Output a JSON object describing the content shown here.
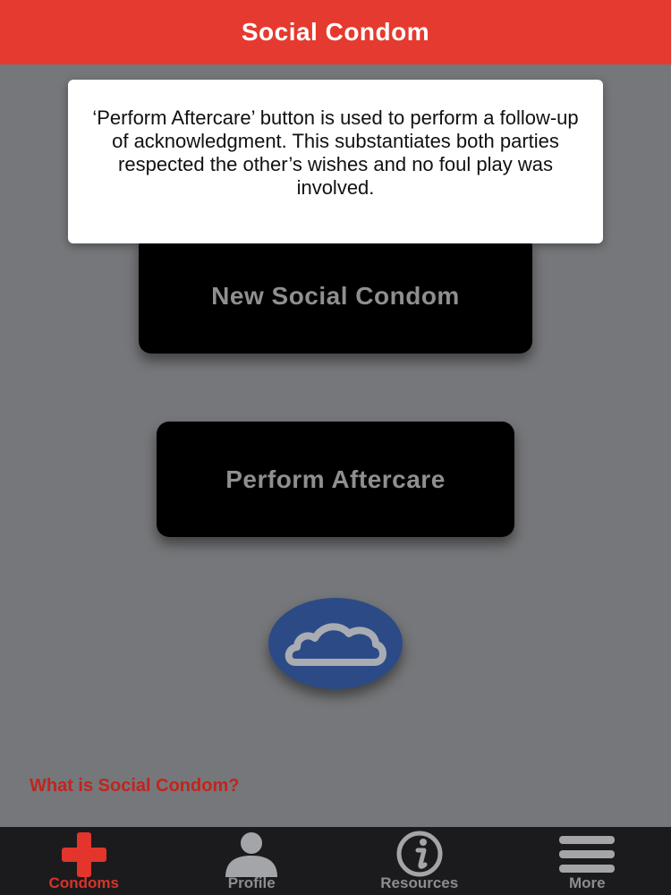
{
  "header": {
    "title": "Social Condom"
  },
  "tooltip": {
    "text": "‘Perform Aftercare’ button is used to perform a follow-up of acknowledgment. This substantiates both parties respected the other’s wishes and no foul play was involved."
  },
  "main": {
    "new_button_label": "New Social Condom",
    "aftercare_button_label": "Perform Aftercare",
    "cloud_icon": "cloud-icon",
    "what_link": "What is Social Condom?"
  },
  "tabbar": {
    "tabs": [
      {
        "label": "Condoms",
        "icon": "red-cross-icon",
        "active": true
      },
      {
        "label": "Profile",
        "icon": "person-icon",
        "active": false
      },
      {
        "label": "Resources",
        "icon": "info-icon",
        "active": false
      },
      {
        "label": "More",
        "icon": "hamburger-menu-icon",
        "active": false
      }
    ]
  },
  "colors": {
    "header": "#e53a2f",
    "background": "#76777a",
    "button": "#000000",
    "cloud_button": "#2c4b86",
    "link": "#c2241e",
    "tabbar": "#1b1b1d",
    "active_tab": "#d8342a"
  }
}
